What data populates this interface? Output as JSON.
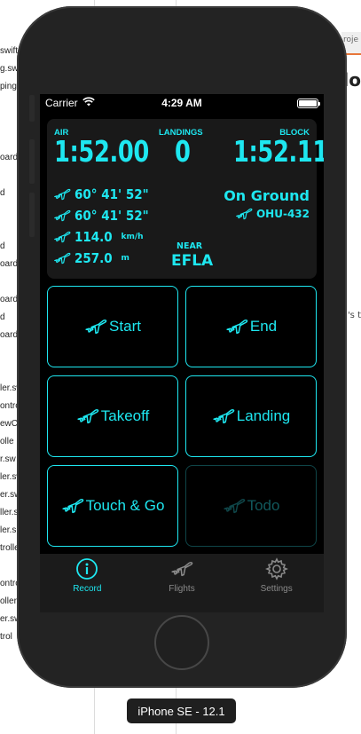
{
  "background_editor": {
    "file_fragments": [
      "swift",
      "g.sw",
      "ping",
      "oard",
      "d",
      "d",
      "oard",
      "oard",
      "d",
      "oard",
      "ler.sw",
      "ontro",
      "ewC",
      "olle",
      "r.sw",
      "ler.sw",
      "er.sw",
      "ller.sw",
      "ler.s",
      "trolle",
      "ontro",
      "oller",
      "er.sw",
      "trol"
    ],
    "tab_label": "roje",
    "title_fragment": "flo",
    "side_text": "'s t"
  },
  "status_bar": {
    "carrier": "Carrier",
    "time": "4:29 AM"
  },
  "summary": {
    "air_label": "AIR",
    "air_time": "1:52.00",
    "landings_label": "LANDINGS",
    "landings_count": "0",
    "block_label": "BLOCK",
    "block_time": "1:52.11",
    "latitude": "60° 41' 52\"",
    "longitude": "60° 41' 52\"",
    "speed": "114.0",
    "speed_unit": "km/h",
    "altitude": "257.0",
    "altitude_unit": "m",
    "status": "On Ground",
    "registration": "OHU-432",
    "near_label": "NEAR",
    "near_airport": "EFLA"
  },
  "buttons": {
    "start": "Start",
    "end": "End",
    "takeoff": "Takeoff",
    "landing": "Landing",
    "touch_go": "Touch & Go",
    "todo": "Todo"
  },
  "tabs": {
    "record": "Record",
    "flights": "Flights",
    "settings": "Settings"
  },
  "simulator_label": "iPhone SE - 12.1",
  "colors": {
    "accent": "#1ee7f0",
    "disabled": "#0f4548"
  }
}
